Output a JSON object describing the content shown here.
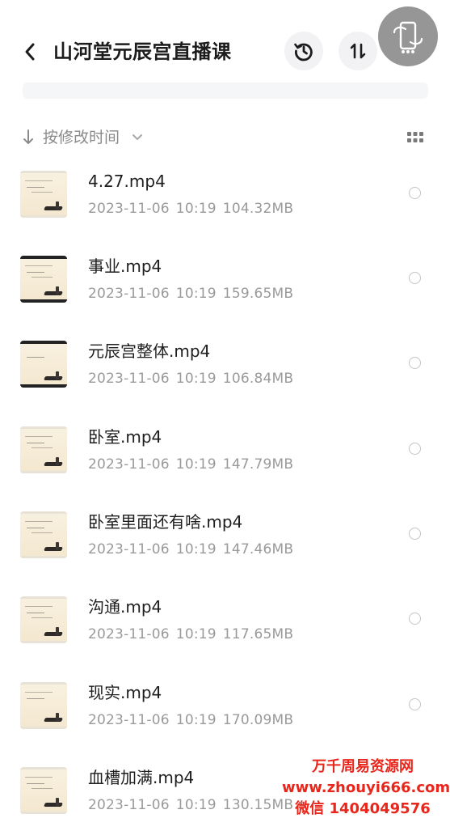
{
  "header": {
    "title": "山河堂元辰宫直播课"
  },
  "sort": {
    "label": "按修改时间"
  },
  "files": [
    {
      "name": "4.27.mp4",
      "date": "2023-11-06",
      "time": "10:19",
      "size": "104.32MB"
    },
    {
      "name": "事业.mp4",
      "date": "2023-11-06",
      "time": "10:19",
      "size": "159.65MB"
    },
    {
      "name": "元辰宫整体.mp4",
      "date": "2023-11-06",
      "time": "10:19",
      "size": "106.84MB"
    },
    {
      "name": "卧室.mp4",
      "date": "2023-11-06",
      "time": "10:19",
      "size": "147.79MB"
    },
    {
      "name": "卧室里面还有啥.mp4",
      "date": "2023-11-06",
      "time": "10:19",
      "size": "147.46MB"
    },
    {
      "name": "沟通.mp4",
      "date": "2023-11-06",
      "time": "10:19",
      "size": "117.65MB"
    },
    {
      "name": "现实.mp4",
      "date": "2023-11-06",
      "time": "10:19",
      "size": "170.09MB"
    },
    {
      "name": "血槽加满.mp4",
      "date": "2023-11-06",
      "time": "10:19",
      "size": "130.15MB"
    }
  ],
  "watermark": {
    "line1": "万千周易资源网",
    "line2": "www.zhouyi666.com",
    "line3": "微信 1404049576"
  },
  "icons": {
    "back": "chevron-left-icon",
    "history": "history-icon",
    "sort": "sort-arrows-icon",
    "float": "floating-assistant-icon",
    "sort_arrow": "arrow-down-icon",
    "sort_chevron": "chevron-down-icon",
    "grid": "grid-view-icon"
  },
  "colors": {
    "text_primary": "#1c1c1c",
    "text_secondary": "#9a9a9a",
    "watermark": "#e8261c"
  }
}
